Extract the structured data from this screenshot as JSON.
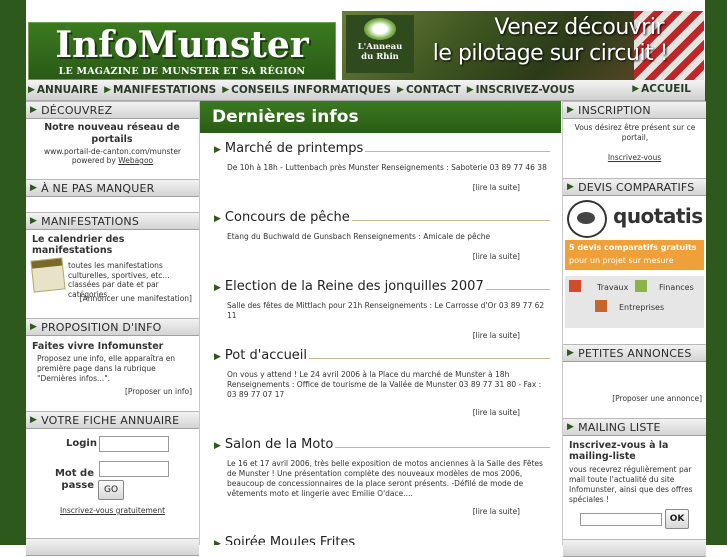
{
  "header": {
    "logo_title": "InfoMunster",
    "logo_tagline": "LE MAGAZINE DE MUNSTER ET SA RÉGION",
    "banner_brand_line1": "L'Anneau",
    "banner_brand_line2": "du Rhin",
    "banner_line1": "Venez découvrir",
    "banner_line2": "le pilotage sur circuit !"
  },
  "nav": {
    "items": [
      "ANNUAIRE",
      "MANIFESTATIONS",
      "CONSEILS INFORMATIQUES",
      "CONTACT",
      "INSCRIVEZ-VOUS"
    ],
    "home": "ACCUEIL"
  },
  "left": {
    "decouvrez": {
      "heading": "DÉCOUVREZ",
      "title": "Notre nouveau réseau de portails",
      "url": "www.portail-de-canton.com/munster",
      "powered": "powered by",
      "powered_link": "Webagoo"
    },
    "ne_pas_manquer": {
      "heading": "À NE PAS MANQUER"
    },
    "manifestations": {
      "heading": "MANIFESTATIONS",
      "title": "Le calendrier des manifestations",
      "text": "toutes les manifestations culturelles, sportives, etc... classées par date et par catégories.",
      "link": "[Annoncer une manifestation]"
    },
    "proposition": {
      "heading": "PROPOSITION D'INFO",
      "title": "Faites vivre Infomunster",
      "text": "Proposez une info, elle apparaîtra en première page dans la rubrique \"Dernières infos...\".",
      "link": "[Proposer un info]"
    },
    "fiche": {
      "heading": "VOTRE FICHE ANNUAIRE",
      "login_label": "Login",
      "password_label": "Mot de passe",
      "go": "GO",
      "register": "Inscrivez-vous gratuitement"
    }
  },
  "center": {
    "title": "Dernières infos",
    "more": "[lire la suite]",
    "news": [
      {
        "title": "Marché de printemps",
        "body": "De 10h à 18h - Luttenbach près Munster Renseignements : Saboterie 03 89 77 46 38"
      },
      {
        "title": "Concours de pêche",
        "body": "Etang du Buchwald de Gunsbach Renseignements : Amicale de pêche"
      },
      {
        "title": "Election de la Reine des jonquilles 2007",
        "body": "Salle des fêtes de Mittlach pour 21h Renseignements : Le Carrosse d'Or 03 89 77 62 11"
      },
      {
        "title": "Pot d'accueil",
        "body": "On vous y attend ! Le 24 avril 2006 à la Place du marché de Munster à 18h Renseignements : Office de tourisme de la Vallée de Munster 03 89 77 31 80 - Fax : 03 89 77 07 17"
      },
      {
        "title": "Salon de la Moto",
        "body": "Le 16 et 17 avril 2006, très belle exposition de motos anciennes à la Salle des Fêtes de Munster ! Une présentation complète des nouveaux modèles de mos 2006, beaucoup de concessionnaires de la place seront présents. -Défilé de mode de vêtements moto et lingerie avec Emilie O'dace...."
      },
      {
        "title": "Soirée Moules Frites",
        "body": ""
      }
    ]
  },
  "right": {
    "inscription": {
      "heading": "INSCRIPTION",
      "text": "Vous désirez être présent sur ce portail,",
      "link": "Inscrivez-vous"
    },
    "devis": {
      "heading": "DEVIS COMPARATIFS",
      "brand": "quotatis",
      "promo1": "5 devis comparatifs gratuits",
      "promo2": "pour un projet sur mesure",
      "cat1": "Travaux",
      "cat2": "Finances",
      "cat3": "Entreprises"
    },
    "annonces": {
      "heading": "PETITES ANNONCES",
      "link": "[Proposer une annonce]"
    },
    "mailing": {
      "heading": "MAILING LISTE",
      "title": "Inscrivez-vous à la mailing-liste",
      "text": "vous recevrez régulièrement par mail toute l'actualité du site Infomunster, ainsi que des offres spéciales !",
      "ok": "OK"
    }
  },
  "colors": {
    "brand_green": "#2d5a1c",
    "title_green": "#3a7a1f"
  }
}
